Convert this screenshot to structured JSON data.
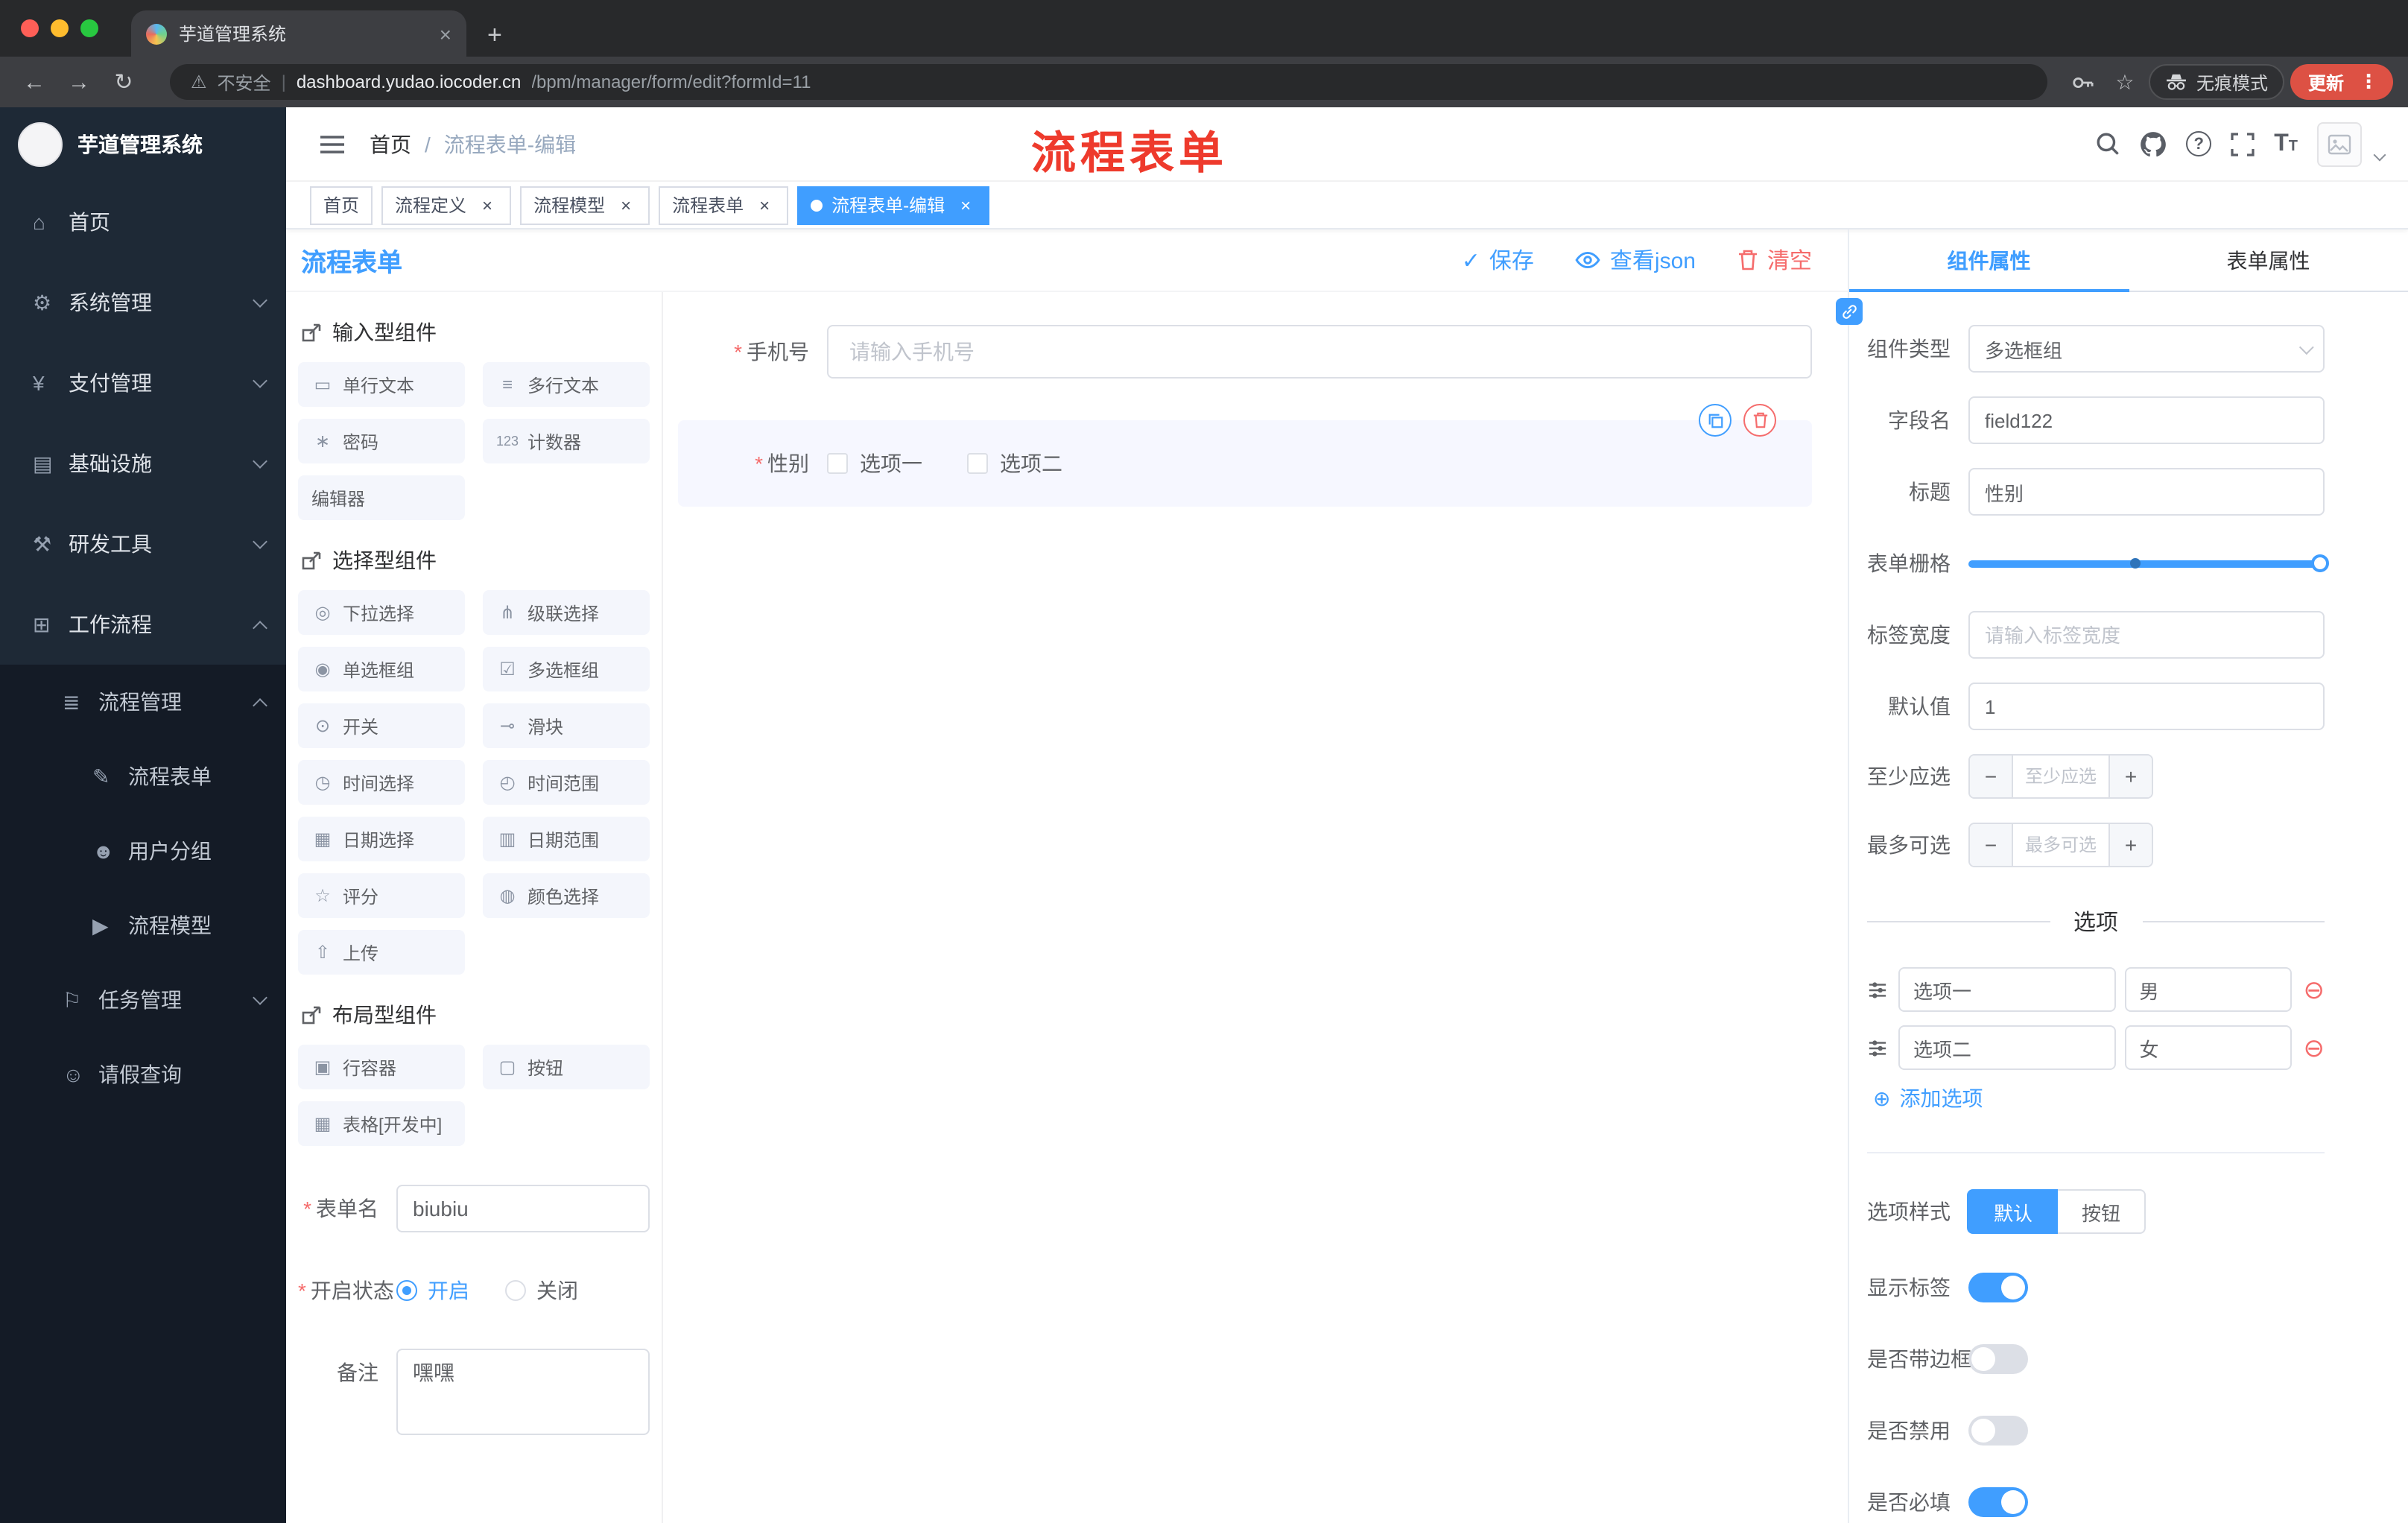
{
  "colors": {
    "primary": "#409eff",
    "danger": "#f56c6c",
    "annotation_red": "#ee3a2c",
    "update_button": "#dd5144",
    "sidebar_bg": "#141b26",
    "sidebar_item_bg": "#1e2936"
  },
  "icons": {
    "back": "←",
    "forward": "→",
    "reload": "↻",
    "warning": "⚠",
    "star": "☆",
    "kebab": "⋮",
    "close": "×",
    "plus": "+",
    "check": "✓",
    "remove": "⊖",
    "add": "⊕",
    "breadcrumb_sep": "/",
    "url_sep": "|"
  },
  "browser": {
    "tab_title": "芋道管理系统",
    "security_label": "不安全",
    "url_host": "dashboard.yudao.iocoder.cn",
    "url_path": "/bpm/manager/form/edit?formId=11",
    "incognito_label": "无痕模式",
    "update_label": "更新"
  },
  "sidebar": {
    "logo_text": "芋道管理系统",
    "menu": [
      {
        "glyph": "⌂",
        "label": "首页"
      },
      {
        "glyph": "⚙",
        "label": "系统管理"
      },
      {
        "glyph": "¥",
        "label": "支付管理"
      },
      {
        "glyph": "▤",
        "label": "基础设施"
      },
      {
        "glyph": "⚒",
        "label": "研发工具"
      },
      {
        "glyph": "⊞",
        "label": "工作流程"
      },
      {
        "glyph": "≣",
        "label": "流程管理"
      },
      {
        "glyph": "✎",
        "label": "流程表单"
      },
      {
        "glyph": "☻",
        "label": "用户分组"
      },
      {
        "glyph": "▶",
        "label": "流程模型"
      },
      {
        "glyph": "⚐",
        "label": "任务管理"
      },
      {
        "glyph": "☺",
        "label": "请假查询"
      }
    ]
  },
  "navbar": {
    "breadcrumb_home": "首页",
    "breadcrumb_current": "流程表单-编辑",
    "annotation": "流程表单"
  },
  "tags": [
    {
      "label": "首页"
    },
    {
      "label": "流程定义"
    },
    {
      "label": "流程模型"
    },
    {
      "label": "流程表单"
    },
    {
      "label": "流程表单-编辑"
    }
  ],
  "editor": {
    "title": "流程表单",
    "save_label": "保存",
    "view_json_label": "查看json",
    "clear_label": "清空"
  },
  "palette": {
    "groups": [
      {
        "title": "输入型组件",
        "items": [
          {
            "glyph": "▭",
            "label": "单行文本"
          },
          {
            "glyph": "≡",
            "label": "多行文本"
          },
          {
            "glyph": "∗",
            "label": "密码"
          },
          {
            "glyph": "123",
            "label": "计数器"
          },
          {
            "glyph": "",
            "label": "编辑器"
          }
        ]
      },
      {
        "title": "选择型组件",
        "items": [
          {
            "glyph": "◎",
            "label": "下拉选择"
          },
          {
            "glyph": "⋔",
            "label": "级联选择"
          },
          {
            "glyph": "◉",
            "label": "单选框组"
          },
          {
            "glyph": "☑",
            "label": "多选框组"
          },
          {
            "glyph": "⊙",
            "label": "开关"
          },
          {
            "glyph": "⊸",
            "label": "滑块"
          },
          {
            "glyph": "◷",
            "label": "时间选择"
          },
          {
            "glyph": "◴",
            "label": "时间范围"
          },
          {
            "glyph": "▦",
            "label": "日期选择"
          },
          {
            "glyph": "▥",
            "label": "日期范围"
          },
          {
            "glyph": "☆",
            "label": "评分"
          },
          {
            "glyph": "◍",
            "label": "颜色选择"
          },
          {
            "glyph": "⇧",
            "label": "上传"
          }
        ]
      },
      {
        "title": "布局型组件",
        "items": [
          {
            "glyph": "▣",
            "label": "行容器"
          },
          {
            "glyph": "▢",
            "label": "按钮"
          },
          {
            "glyph": "▦",
            "label": "表格[开发中]"
          }
        ]
      }
    ],
    "form_meta": {
      "name_label": "表单名",
      "name_value": "biubiu",
      "status_label": "开启状态",
      "status_on": "开启",
      "status_off": "关闭",
      "remark_label": "备注",
      "remark_value": "嘿嘿"
    }
  },
  "canvas": {
    "phone_label": "手机号",
    "phone_placeholder": "请输入手机号",
    "gender_label": "性别",
    "gender_opt1": "选项一",
    "gender_opt2": "选项二"
  },
  "props": {
    "tab_component": "组件属性",
    "tab_form": "表单属性",
    "component_type_label": "组件类型",
    "component_type_value": "多选框组",
    "field_name_label": "字段名",
    "field_name_value": "field122",
    "title_label": "标题",
    "title_value": "性别",
    "grid_label": "表单栅格",
    "label_width_label": "标签宽度",
    "label_width_placeholder": "请输入标签宽度",
    "default_label": "默认值",
    "default_value": "1",
    "min_label": "至少应选",
    "min_placeholder": "至少应选",
    "max_label": "最多可选",
    "max_placeholder": "最多可选",
    "options_divider": "选项",
    "options": [
      {
        "name": "选项一",
        "value": "男"
      },
      {
        "name": "选项二",
        "value": "女"
      }
    ],
    "add_option_label": "添加选项",
    "option_style_label": "选项样式",
    "style_default": "默认",
    "style_button": "按钮",
    "switch_show_label": "显示标签",
    "switch_border_label": "是否带边框",
    "switch_disabled_label": "是否禁用",
    "switch_required_label": "是否必填"
  }
}
